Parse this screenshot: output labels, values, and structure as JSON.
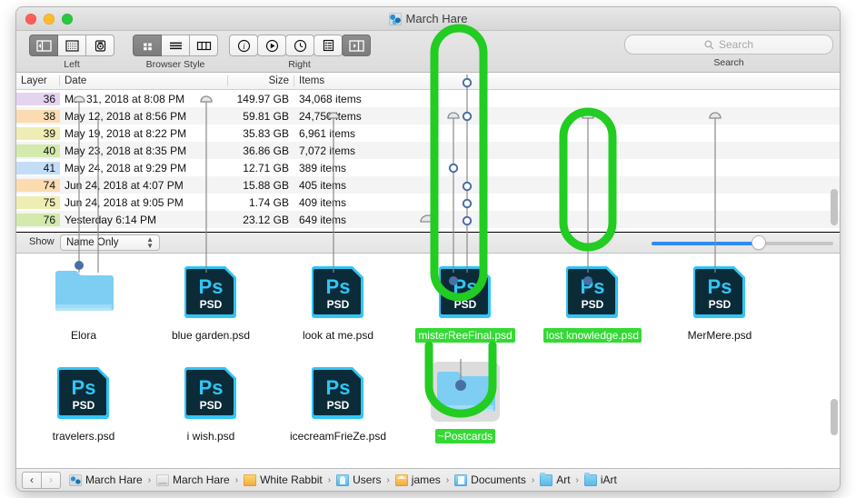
{
  "window": {
    "title": "March Hare",
    "title_icon": "app-icon",
    "traffic_lights": [
      "close-button",
      "minimize-button",
      "zoom-button"
    ]
  },
  "toolbar": {
    "groups": [
      {
        "name": "left",
        "label": "Left",
        "buttons": [
          {
            "icon": "sidebar-toggle-icon",
            "selected": true
          },
          {
            "icon": "grid-preview-icon",
            "selected": false
          },
          {
            "icon": "device-icon",
            "selected": false
          }
        ]
      },
      {
        "name": "browser-style",
        "label": "Browser Style",
        "buttons": [
          {
            "icon": "icon-view-icon",
            "selected": true
          },
          {
            "icon": "list-view-icon",
            "selected": false
          },
          {
            "icon": "column-view-icon",
            "selected": false
          }
        ]
      },
      {
        "name": "right",
        "label": "Right",
        "buttons": [
          {
            "icon": "info-icon",
            "selected": false
          },
          {
            "icon": "play-icon",
            "selected": false
          },
          {
            "icon": "clock-icon",
            "selected": false
          },
          {
            "icon": "list-detail-icon",
            "selected": false
          },
          {
            "icon": "inspector-toggle-icon",
            "selected": true
          }
        ]
      }
    ]
  },
  "search": {
    "placeholder": "Search",
    "value": "",
    "label": "Search",
    "icon": "search-icon"
  },
  "table": {
    "columns": [
      "Layer",
      "Date",
      "Size",
      "Items"
    ],
    "rows": [
      {
        "layer": "36",
        "date": "Mar 31, 2018 at 8:08 PM",
        "size": "149.97 GB",
        "items": "34,068 items",
        "swatch": "#e4d4f0"
      },
      {
        "layer": "38",
        "date": "May 12, 2018 at 8:56 PM",
        "size": "59.81 GB",
        "items": "24,750 items",
        "swatch": "#fadcb0"
      },
      {
        "layer": "39",
        "date": "May 19, 2018 at 8:22 PM",
        "size": "35.83 GB",
        "items": "6,961 items",
        "swatch": "#eeeeb4"
      },
      {
        "layer": "40",
        "date": "May 23, 2018 at 8:35 PM",
        "size": "36.86 GB",
        "items": "7,072 items",
        "swatch": "#d3eaac"
      },
      {
        "layer": "41",
        "date": "May 24, 2018 at 9:29 PM",
        "size": "12.71 GB",
        "items": "389 items",
        "swatch": "#c4ddf7"
      },
      {
        "layer": "74",
        "date": "Jun 24, 2018 at 4:07 PM",
        "size": "15.88 GB",
        "items": "405 items",
        "swatch": "#fadcb0"
      },
      {
        "layer": "75",
        "date": "Jun 24, 2018 at 9:05 PM",
        "size": "1.74 GB",
        "items": "409 items",
        "swatch": "#eeeeb4"
      },
      {
        "layer": "76",
        "date": "Yesterday 6:14 PM",
        "size": "23.12 GB",
        "items": "649 items",
        "swatch": "#d3eaac"
      }
    ]
  },
  "showbar": {
    "label": "Show",
    "popup_value": "Name Only",
    "popup_options": [
      "Name Only"
    ],
    "zoom_percent": 59
  },
  "files": [
    {
      "name": "Elora",
      "kind": "folder-blue",
      "selected": false
    },
    {
      "name": "blue garden.psd",
      "kind": "psd",
      "selected": false
    },
    {
      "name": "look at me.psd",
      "kind": "psd",
      "selected": false
    },
    {
      "name": "misterReeFinal.psd",
      "kind": "psd",
      "selected": true
    },
    {
      "name": "lost knowledge.psd",
      "kind": "psd",
      "selected": true
    },
    {
      "name": "MerMere.psd",
      "kind": "psd",
      "selected": false
    },
    {
      "name": "travelers.psd",
      "kind": "psd",
      "selected": false
    },
    {
      "name": "i wish.psd",
      "kind": "psd",
      "selected": false
    },
    {
      "name": "icecreamFrieZe.psd",
      "kind": "psd",
      "selected": false
    },
    {
      "name": "~Postcards",
      "kind": "folder-blue",
      "selected": true
    }
  ],
  "psd_badge": {
    "mark": "Ps",
    "label": "PSD"
  },
  "pathbar": {
    "back_label": "‹",
    "forward_label": "›",
    "separator": "›",
    "crumbs": [
      {
        "label": "March Hare",
        "icon": "app-icon"
      },
      {
        "label": "March Hare",
        "icon": "disk-icon"
      },
      {
        "label": "White Rabbit",
        "icon": "harddisk-icon"
      },
      {
        "label": "Users",
        "icon": "users-folder-icon"
      },
      {
        "label": "james",
        "icon": "home-folder-icon"
      },
      {
        "label": "Documents",
        "icon": "documents-folder-icon"
      },
      {
        "label": "Art",
        "icon": "folder-icon"
      },
      {
        "label": "iArt",
        "icon": "folder-icon"
      }
    ]
  },
  "colors": {
    "accent_green": "#22cc22",
    "selection_green": "#35d935",
    "slider_blue": "#2d8cf0",
    "psd_blue": "#31c5f4",
    "psd_dark": "#0b2b38",
    "pin_blue": "#4a6fa5"
  }
}
